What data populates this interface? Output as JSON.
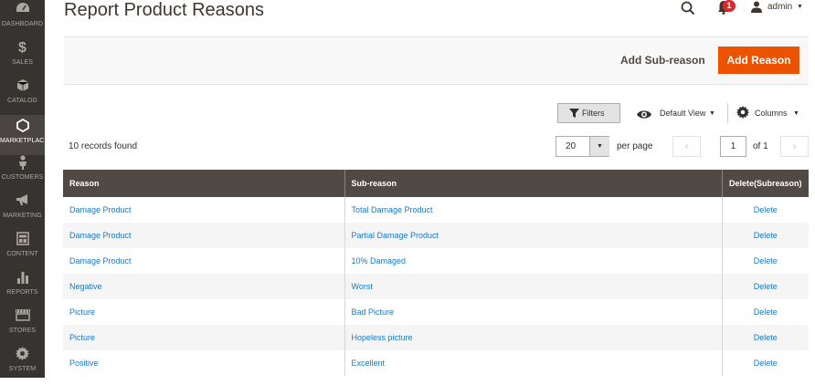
{
  "sidebar": {
    "items": [
      {
        "label": "DASHBOARD",
        "icon": "dashboard-icon"
      },
      {
        "label": "SALES",
        "icon": "dollar-icon"
      },
      {
        "label": "CATALOG",
        "icon": "cube-icon"
      },
      {
        "label": "MARKETPLACE",
        "icon": "hexagon-icon"
      },
      {
        "label": "CUSTOMERS",
        "icon": "person-icon"
      },
      {
        "label": "MARKETING",
        "icon": "megaphone-icon"
      },
      {
        "label": "CONTENT",
        "icon": "layout-icon"
      },
      {
        "label": "REPORTS",
        "icon": "bar-chart-icon"
      },
      {
        "label": "STORES",
        "icon": "store-icon"
      },
      {
        "label": "SYSTEM",
        "icon": "gear-icon"
      }
    ]
  },
  "header": {
    "title": "Report Product Reasons",
    "notification_count": "1",
    "user": "admin"
  },
  "actions": {
    "add_subreason": "Add Sub-reason",
    "add_reason": "Add Reason"
  },
  "toolbar": {
    "filters": "Filters",
    "view": "Default View",
    "columns": "Columns"
  },
  "grid": {
    "records_found": "10 records found",
    "per_page_value": "20",
    "per_page_label": "per page",
    "current_page": "1",
    "of_pages": "of 1",
    "headers": [
      "Reason",
      "Sub-reason",
      "Delete(Subreason)"
    ],
    "rows": [
      {
        "reason": "Damage Product",
        "subreason": "Total Damage Product",
        "action": "Delete"
      },
      {
        "reason": "Damage Product",
        "subreason": "Partial Damage Product",
        "action": "Delete"
      },
      {
        "reason": "Damage Product",
        "subreason": "10% Damaged",
        "action": "Delete"
      },
      {
        "reason": "Negative",
        "subreason": "Worst",
        "action": "Delete"
      },
      {
        "reason": "Picture",
        "subreason": "Bad Picture",
        "action": "Delete"
      },
      {
        "reason": "Picture",
        "subreason": "Hopeless picture",
        "action": "Delete"
      },
      {
        "reason": "Positive",
        "subreason": "Excellent",
        "action": "Delete"
      }
    ]
  },
  "colors": {
    "sidebar_bg": "#373330",
    "accent": "#eb5202",
    "header_bg": "#514943",
    "link": "#1979c3"
  }
}
